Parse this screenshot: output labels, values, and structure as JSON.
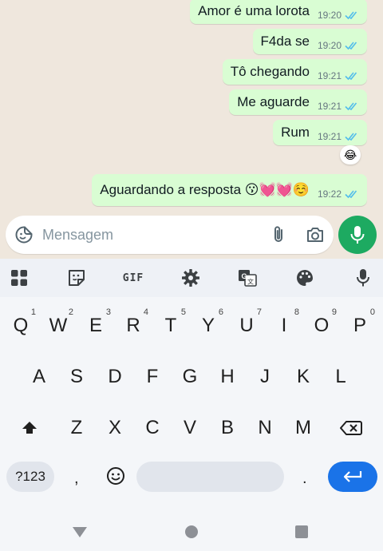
{
  "messages": [
    {
      "text": "Amor é uma lorota",
      "time": "19:20"
    },
    {
      "text": "F4da se",
      "time": "19:20"
    },
    {
      "text": "Tô chegando",
      "time": "19:21"
    },
    {
      "text": "Me aguarde",
      "time": "19:21"
    },
    {
      "text": "Rum",
      "time": "19:21"
    },
    {
      "text": "Aguardando a resposta 😗💓💓☺️",
      "time": "19:22"
    }
  ],
  "reaction": "😂",
  "composer": {
    "placeholder": "Mensagem"
  },
  "keyboard": {
    "toolbar_gif": "GIF",
    "row1": [
      "Q",
      "W",
      "E",
      "R",
      "T",
      "Y",
      "U",
      "I",
      "O",
      "P"
    ],
    "row1_hints": [
      "1",
      "2",
      "3",
      "4",
      "5",
      "6",
      "7",
      "8",
      "9",
      "0"
    ],
    "row2": [
      "A",
      "S",
      "D",
      "F",
      "G",
      "H",
      "J",
      "K",
      "L"
    ],
    "row3": [
      "Z",
      "X",
      "C",
      "V",
      "B",
      "N",
      "M"
    ],
    "symbols_label": "?123",
    "comma": ",",
    "period": "."
  },
  "colors": {
    "bubble": "#d9fdd3",
    "tick_read": "#53bdeb",
    "mic_fab": "#1daa61",
    "enter": "#1a73e8"
  }
}
